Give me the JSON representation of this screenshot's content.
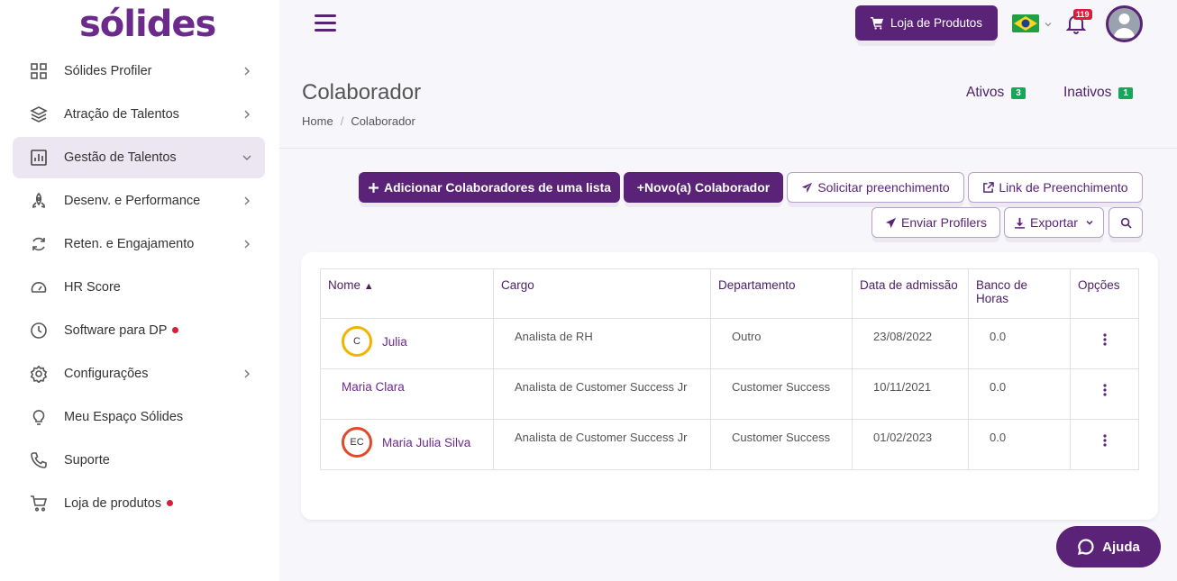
{
  "brand": {
    "logo_text": "sólides",
    "accent": "#5a2378"
  },
  "header": {
    "shop_button": "Loja de Produtos",
    "notifications_count": "119"
  },
  "sidebar": {
    "items": [
      {
        "label": "Sólides Profiler",
        "icon": "grid-icon"
      },
      {
        "label": "Atração de Talentos",
        "icon": "layers-icon"
      },
      {
        "label": "Gestão de Talentos",
        "icon": "chart-icon"
      },
      {
        "label": "Desenv. e Performance",
        "icon": "rocket-icon"
      },
      {
        "label": "Reten. e Engajamento",
        "icon": "refresh-icon"
      },
      {
        "label": "HR Score",
        "icon": "gauge-icon"
      },
      {
        "label": "Software para DP",
        "icon": "clock-icon"
      },
      {
        "label": "Configurações",
        "icon": "gear-icon"
      },
      {
        "label": "Meu Espaço Sólides",
        "icon": "bulb-icon"
      },
      {
        "label": "Suporte",
        "icon": "phone-icon"
      },
      {
        "label": "Loja de produtos",
        "icon": "cart-icon"
      }
    ]
  },
  "page": {
    "title": "Colaborador",
    "breadcrumb": [
      "Home",
      "Colaborador"
    ],
    "ativos_label": "Ativos",
    "ativos_count": "3",
    "inativos_label": "Inativos",
    "inativos_count": "1"
  },
  "actions": {
    "add_list": "Adicionar Colaboradores de uma lista",
    "new": "+Novo(a) Colaborador",
    "request": "Solicitar preenchimento",
    "link": "Link de Preenchimento",
    "send": "Enviar Profilers",
    "export": "Exportar"
  },
  "table": {
    "headers": [
      "Nome",
      "Cargo",
      "Departamento",
      "Data de admissão",
      "Banco de Horas",
      "Opções"
    ],
    "sort_indicator": "▲",
    "rows": [
      {
        "initials": "C",
        "name": "Julia",
        "cargo": "Analista de RH",
        "dept": "Outro",
        "date": "23/08/2022",
        "hours": "0.0"
      },
      {
        "initials": "",
        "name": "Maria Clara",
        "cargo": "Analista de Customer Success Jr",
        "dept": "Customer Success",
        "date": "10/11/2021",
        "hours": "0.0"
      },
      {
        "initials": "EC",
        "name": "Maria Julia Silva",
        "cargo": "Analista de Customer Success Jr",
        "dept": "Customer Success",
        "date": "01/02/2023",
        "hours": "0.0"
      }
    ]
  },
  "help": {
    "label": "Ajuda"
  }
}
